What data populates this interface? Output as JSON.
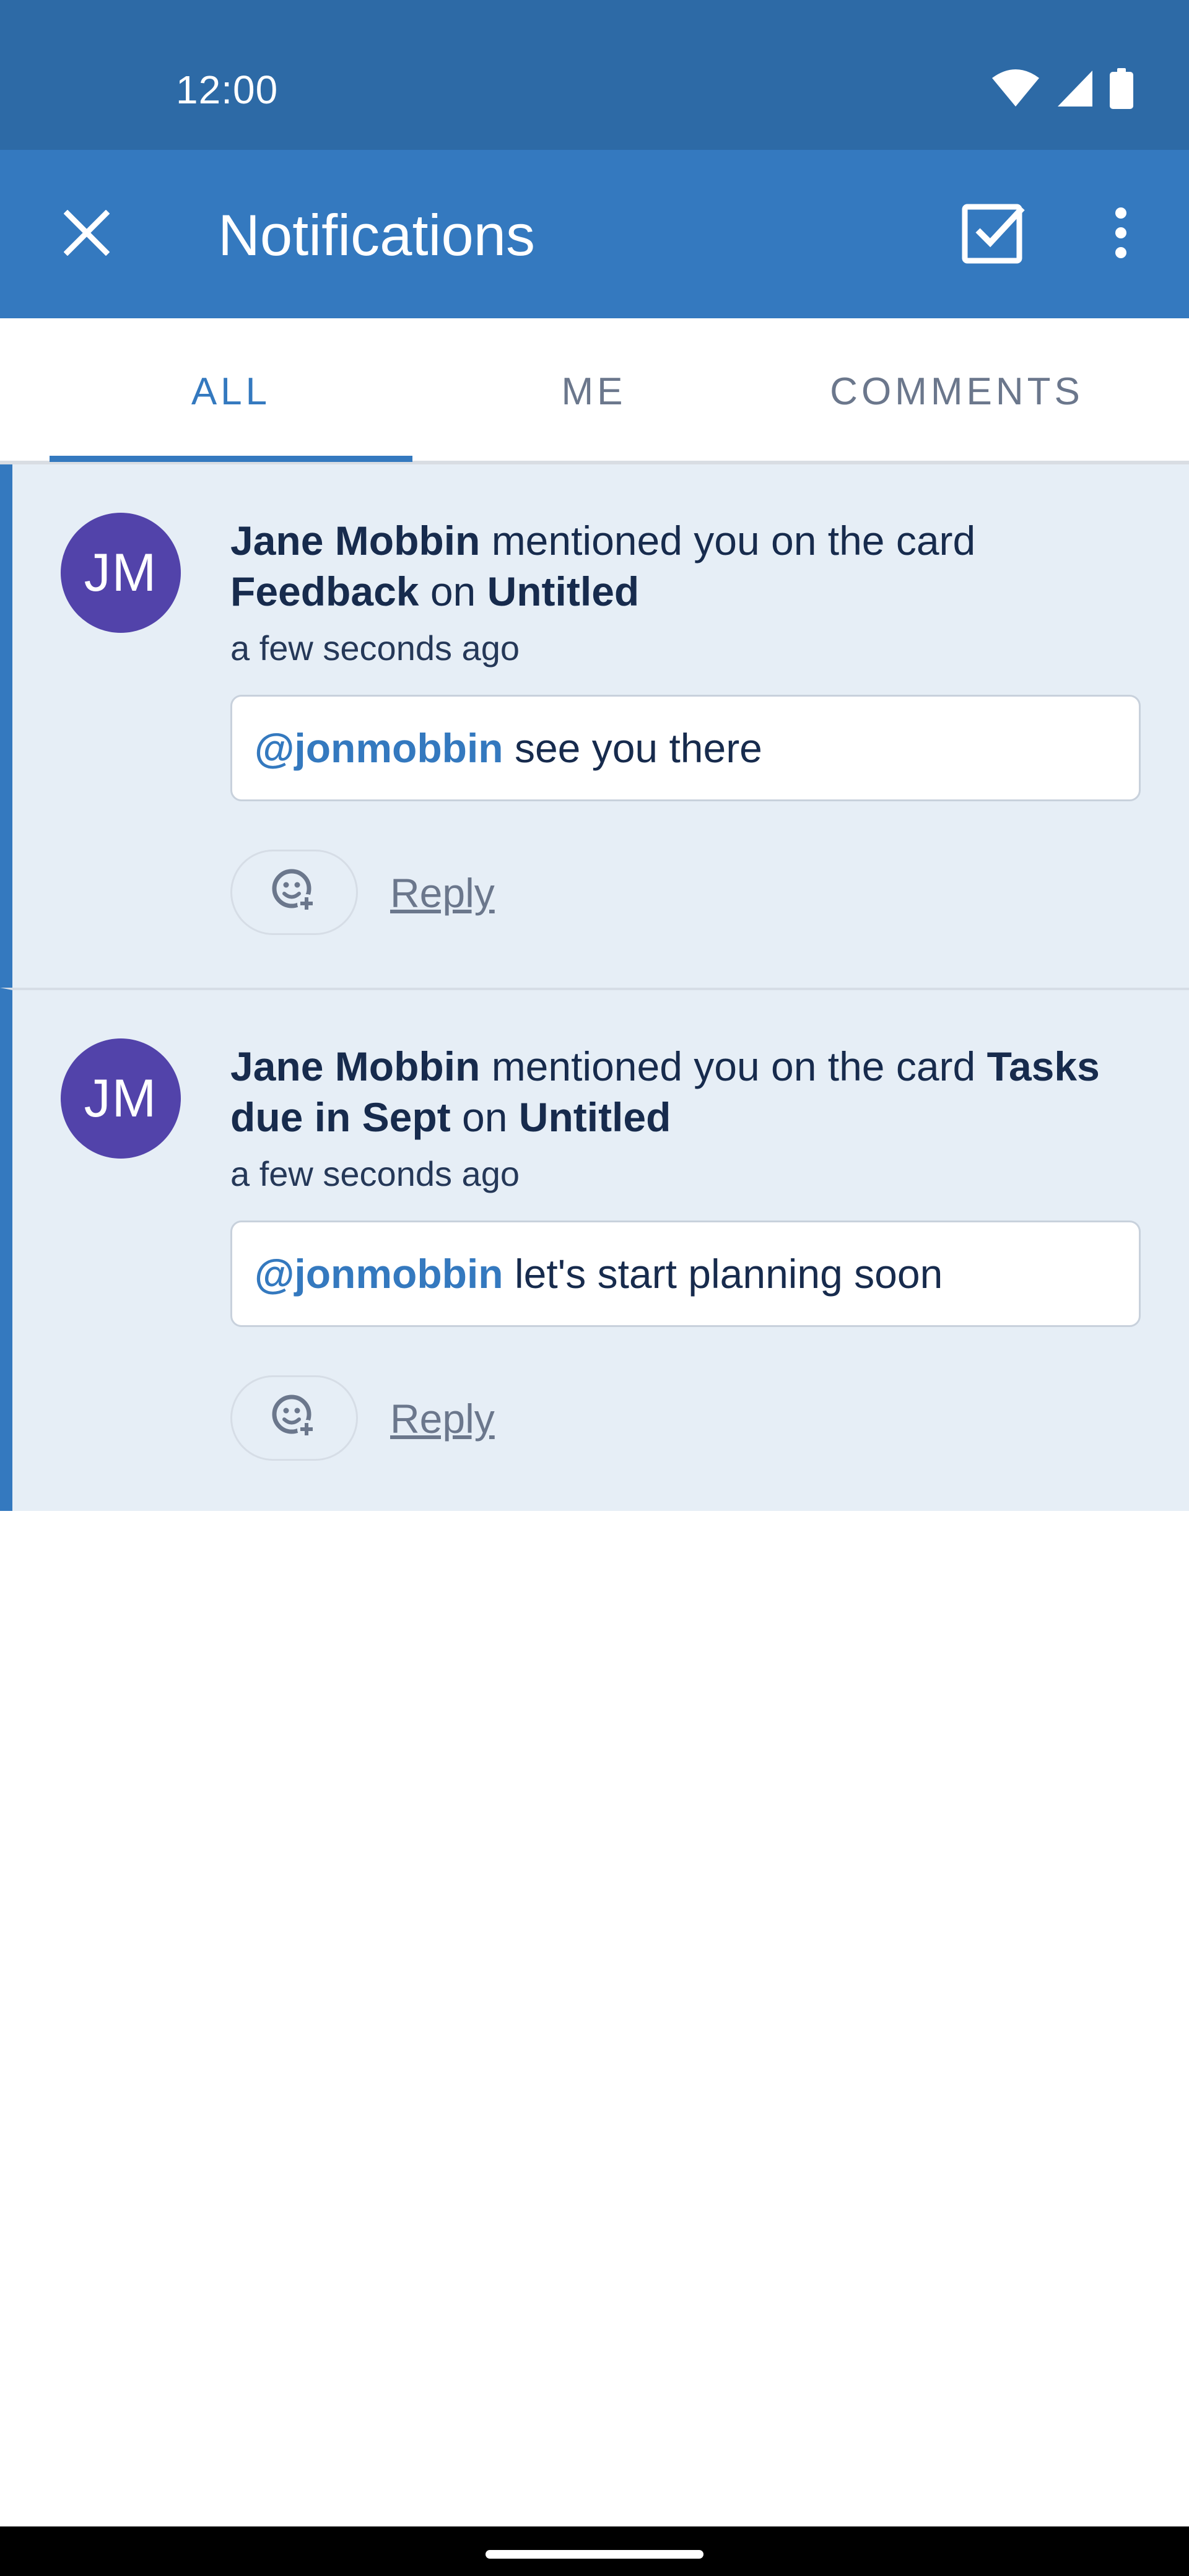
{
  "status_bar": {
    "time": "12:00",
    "icons": [
      "wifi-icon",
      "cellular-signal-icon",
      "battery-icon"
    ]
  },
  "app_bar": {
    "title": "Notifications",
    "close_icon": "close-icon",
    "mark_all_read_icon": "checkbox-checked-icon",
    "more_icon": "more-vertical-icon"
  },
  "tabs": [
    {
      "label": "ALL",
      "active": true
    },
    {
      "label": "ME",
      "active": false
    },
    {
      "label": "COMMENTS",
      "active": false
    }
  ],
  "notifications": [
    {
      "avatar_initials": "JM",
      "actor": "Jane Mobbin",
      "action": " mentioned you on the card ",
      "card": "Feedback",
      "connector": " on ",
      "board": "Untitled",
      "time": "a few seconds ago",
      "mention": "@jonmobbin",
      "comment": " see you there",
      "reply_label": "Reply",
      "unread": true
    },
    {
      "avatar_initials": "JM",
      "actor": "Jane Mobbin",
      "action": " mentioned you on the card ",
      "card": "Tasks due in Sept",
      "connector": " on ",
      "board": "Untitled",
      "time": "a few seconds ago",
      "mention": "@jonmobbin",
      "comment": " let's start planning soon",
      "reply_label": "Reply",
      "unread": true
    }
  ],
  "colors": {
    "status_bar": "#2d6aa6",
    "app_bar": "#3479bf",
    "accent": "#3479bf",
    "unread_background": "#e6eef6",
    "avatar": "#5243aa"
  }
}
